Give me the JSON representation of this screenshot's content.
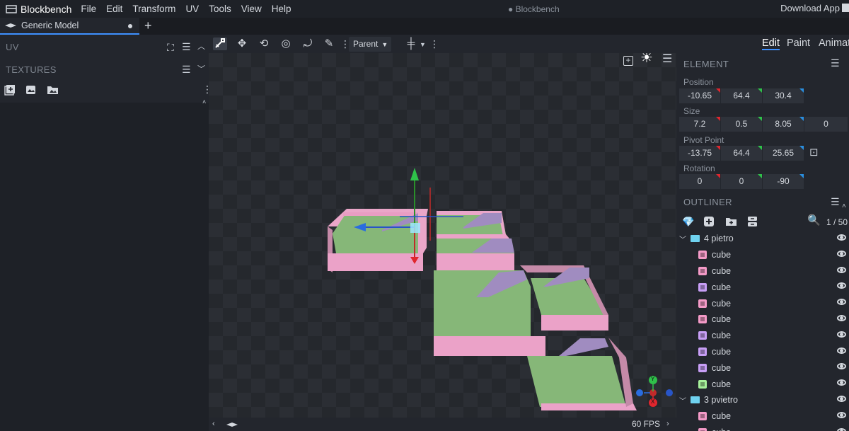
{
  "app": {
    "name": "Blockbench",
    "window_title": "● Blockbench",
    "download": "Download App"
  },
  "menu": [
    "File",
    "Edit",
    "Transform",
    "UV",
    "Tools",
    "View",
    "Help"
  ],
  "tab": {
    "label": "Generic Model"
  },
  "left": {
    "uv_title": "UV",
    "textures_title": "TEXTURES"
  },
  "toolbar": {
    "pivot_select": "Parent"
  },
  "modes": [
    "Edit",
    "Paint",
    "Animat"
  ],
  "element": {
    "title": "ELEMENT",
    "position_label": "Position",
    "position": [
      "-10.65",
      "64.4",
      "30.4"
    ],
    "size_label": "Size",
    "size": [
      "7.2",
      "0.5",
      "8.05",
      "0"
    ],
    "pivot_label": "Pivot Point",
    "pivot": [
      "-13.75",
      "64.4",
      "25.65"
    ],
    "rotation_label": "Rotation",
    "rotation": [
      "0",
      "0",
      "-90"
    ]
  },
  "outliner": {
    "title": "OUTLINER",
    "count": "1 / 50",
    "rows": [
      {
        "type": "group",
        "name": "4 pietro"
      },
      {
        "type": "cube",
        "name": "cube",
        "color": "#f39ac7"
      },
      {
        "type": "cube",
        "name": "cube",
        "color": "#f39ac7"
      },
      {
        "type": "cube",
        "name": "cube",
        "color": "#c79ef5"
      },
      {
        "type": "cube",
        "name": "cube",
        "color": "#f39ac7"
      },
      {
        "type": "cube",
        "name": "cube",
        "color": "#f39ac7"
      },
      {
        "type": "cube",
        "name": "cube",
        "color": "#c79ef5"
      },
      {
        "type": "cube",
        "name": "cube",
        "color": "#c79ef5"
      },
      {
        "type": "cube",
        "name": "cube",
        "color": "#c79ef5"
      },
      {
        "type": "cube",
        "name": "cube",
        "color": "#a6f09a"
      },
      {
        "type": "group",
        "name": "3 pvietro"
      },
      {
        "type": "cube",
        "name": "cube",
        "color": "#f39ac7"
      },
      {
        "type": "cube",
        "name": "cube",
        "color": "#f39ac7"
      }
    ]
  },
  "viewport": {
    "fps": "60 FPS",
    "gizmo": [
      "Y",
      "X"
    ]
  }
}
